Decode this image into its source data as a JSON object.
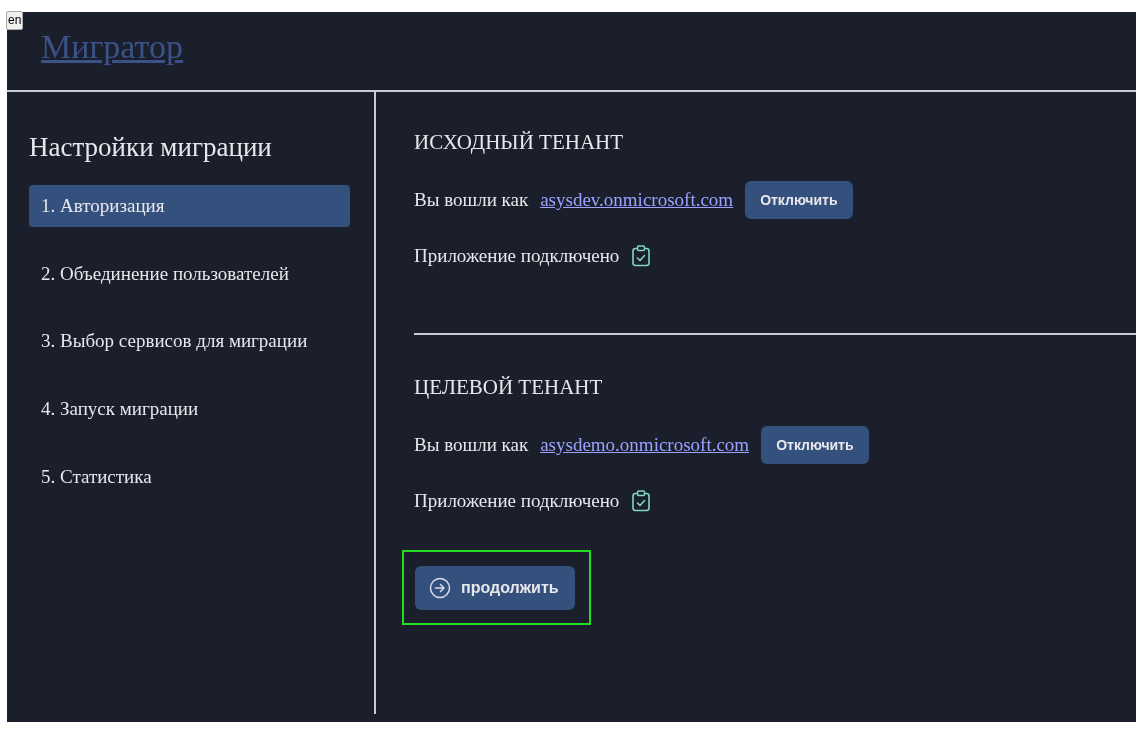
{
  "language_button": "en",
  "header": {
    "title": "Мигратор"
  },
  "sidebar": {
    "title": "Настройки миграции",
    "items": [
      {
        "label": "1. Авторизация",
        "selected": true
      },
      {
        "label": "2. Объединение пользователей",
        "selected": false
      },
      {
        "label": "3. Выбор сервисов для миграции",
        "selected": false
      },
      {
        "label": "4. Запуск миграции",
        "selected": false
      },
      {
        "label": "5. Статистика",
        "selected": false
      }
    ]
  },
  "tenants": [
    {
      "heading": "ИСХОДНЫЙ ТЕНАНТ",
      "signed_in_label": "Вы вошли как",
      "account": "asysdev.onmicrosoft.com",
      "disconnect_button": "Отключить",
      "status": "Приложение подключено",
      "connected": true
    },
    {
      "heading": "ЦЕЛЕВОЙ ТЕНАНТ",
      "signed_in_label": "Вы вошли как",
      "account": "asysdemo.onmicrosoft.com",
      "disconnect_button": "Отключить",
      "status": "Приложение подключено",
      "connected": true
    }
  ],
  "continue_button": {
    "label": "продолжить",
    "highlighted": true
  }
}
